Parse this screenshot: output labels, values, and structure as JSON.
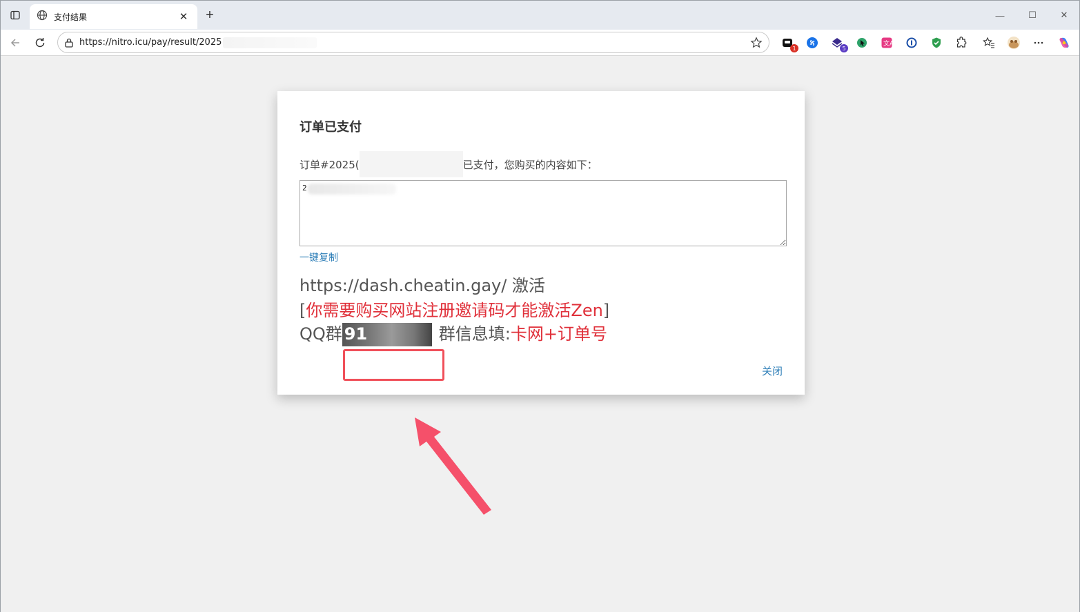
{
  "browser": {
    "tab_title": "支付结果",
    "url": "https://nitro.icu/pay/result/2025",
    "badges": {
      "ext1": "1",
      "ext3": "5"
    },
    "window_controls": {
      "minimize": "—",
      "maximize": "☐",
      "close": "✕"
    }
  },
  "dialog": {
    "heading": "订单已支付",
    "order_prefix": "订单#2025(",
    "order_suffix": "已支付，您购买的内容如下：",
    "textarea_value": "2",
    "copy_label": "一键复制",
    "line1": "https://dash.cheatin.gay/ 激活",
    "line2_open": "[",
    "line2_red": "你需要购买网站注册邀请码才能激活Zen",
    "line2_close": "]",
    "line3_prefix": "QQ群",
    "qq_visible": "91",
    "line3_mid": "群信息填:",
    "line3_red": "卡网+订单号",
    "close_label": "关闭"
  },
  "colors": {
    "link": "#2f7fb8",
    "red_text": "#e0303a",
    "highlight": "#f0505a",
    "arrow": "#f5506a"
  }
}
